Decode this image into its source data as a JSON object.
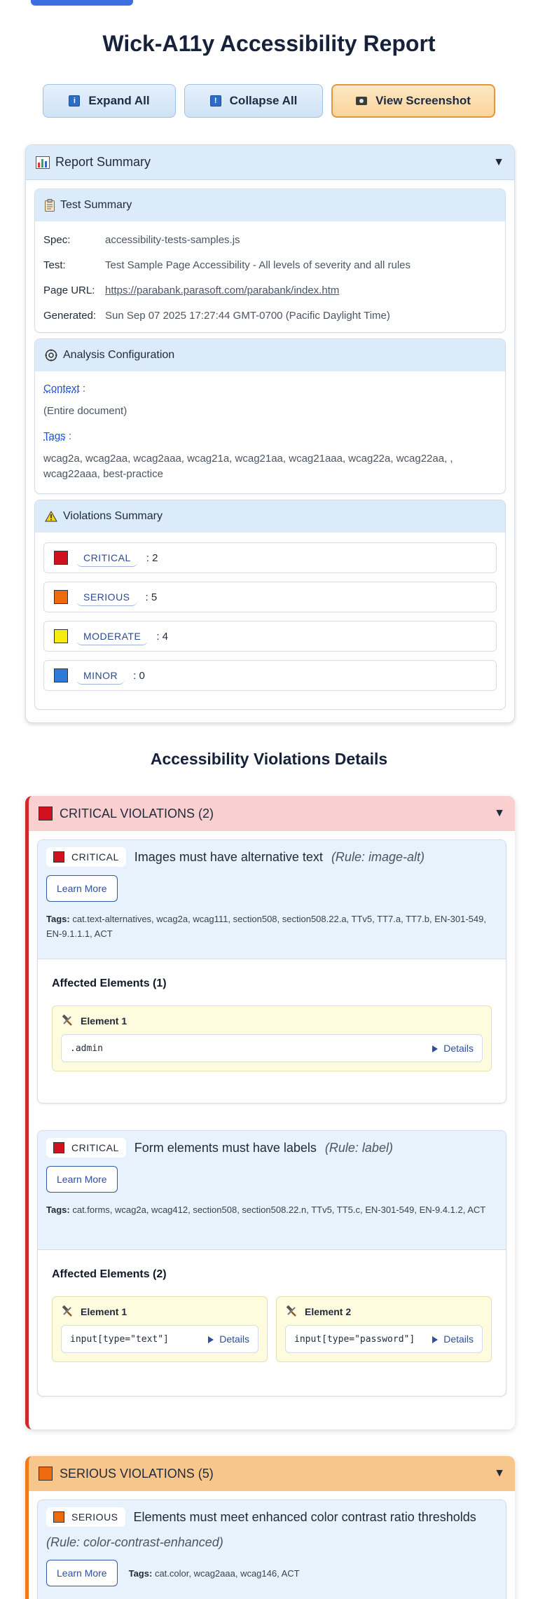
{
  "page": {
    "title": "Wick-A11y Accessibility Report"
  },
  "toolbar": {
    "expand_label": "Expand All",
    "collapse_label": "Collapse All",
    "screenshot_label": "View Screenshot"
  },
  "report_summary": {
    "title": "Report Summary",
    "test_summary": {
      "title": "Test Summary",
      "spec_label": "Spec:",
      "spec_value": "accessibility-tests-samples.js",
      "test_label": "Test:",
      "test_value": "Test Sample Page Accessibility - All levels of severity and all rules",
      "url_label": "Page URL:",
      "url_value": "https://parabank.parasoft.com/parabank/index.htm",
      "generated_label": "Generated:",
      "generated_value": "Sun Sep 07 2025 17:27:44 GMT-0700 (Pacific Daylight Time)"
    },
    "analysis_config": {
      "title": "Analysis Configuration",
      "context_label": "Context",
      "context_value": "(Entire document)",
      "tags_label": "Tags",
      "tags_value": "wcag2a, wcag2aa, wcag2aaa, wcag21a, wcag21aa, wcag21aaa, wcag22a, wcag22aa, , wcag22aaa, best-practice"
    },
    "violations_summary": {
      "title": "Violations Summary",
      "items": [
        {
          "label": "CRITICAL",
          "count": ": 2",
          "color": "#d1111e"
        },
        {
          "label": "SERIOUS",
          "count": ": 5",
          "color": "#ee6a0f"
        },
        {
          "label": "MODERATE",
          "count": ": 4",
          "color": "#f5ec10"
        },
        {
          "label": "MINOR",
          "count": ": 0",
          "color": "#2f7ad8"
        }
      ]
    }
  },
  "details": {
    "title": "Accessibility Violations Details",
    "critical_group": {
      "title": "CRITICAL VIOLATIONS (2)",
      "color": "#d1111e",
      "violations": [
        {
          "severity": "CRITICAL",
          "title": "Images must have alternative text",
          "rule": "(Rule: image-alt)",
          "learn_more": "Learn More",
          "tags_label": "Tags:",
          "tags": "cat.text-alternatives, wcag2a, wcag111, section508, section508.22.a, TTv5, TT7.a, TT7.b, EN-301-549, EN-9.1.1.1, ACT",
          "affected_title": "Affected Elements (1)",
          "elements": [
            {
              "label": "Element 1",
              "selector": ".admin",
              "details": "Details"
            }
          ]
        },
        {
          "severity": "CRITICAL",
          "title": "Form elements must have labels",
          "rule": "(Rule: label)",
          "learn_more": "Learn More",
          "tags_label": "Tags:",
          "tags": "cat.forms, wcag2a, wcag412, section508, section508.22.n, TTv5, TT5.c, EN-301-549, EN-9.4.1.2, ACT",
          "affected_title": "Affected Elements (2)",
          "elements": [
            {
              "label": "Element 1",
              "selector": "input[type=\"text\"]",
              "details": "Details"
            },
            {
              "label": "Element 2",
              "selector": "input[type=\"password\"]",
              "details": "Details"
            }
          ]
        }
      ]
    },
    "serious_group": {
      "title": "SERIOUS VIOLATIONS (5)",
      "color": "#ee6a0f",
      "violations": [
        {
          "severity": "SERIOUS",
          "title": "Elements must meet enhanced color contrast ratio thresholds",
          "rule": "(Rule: color-contrast-enhanced)",
          "learn_more": "Learn More",
          "tags_label": "Tags:",
          "tags": "cat.color, wcag2aaa, wcag146, ACT"
        }
      ]
    }
  }
}
